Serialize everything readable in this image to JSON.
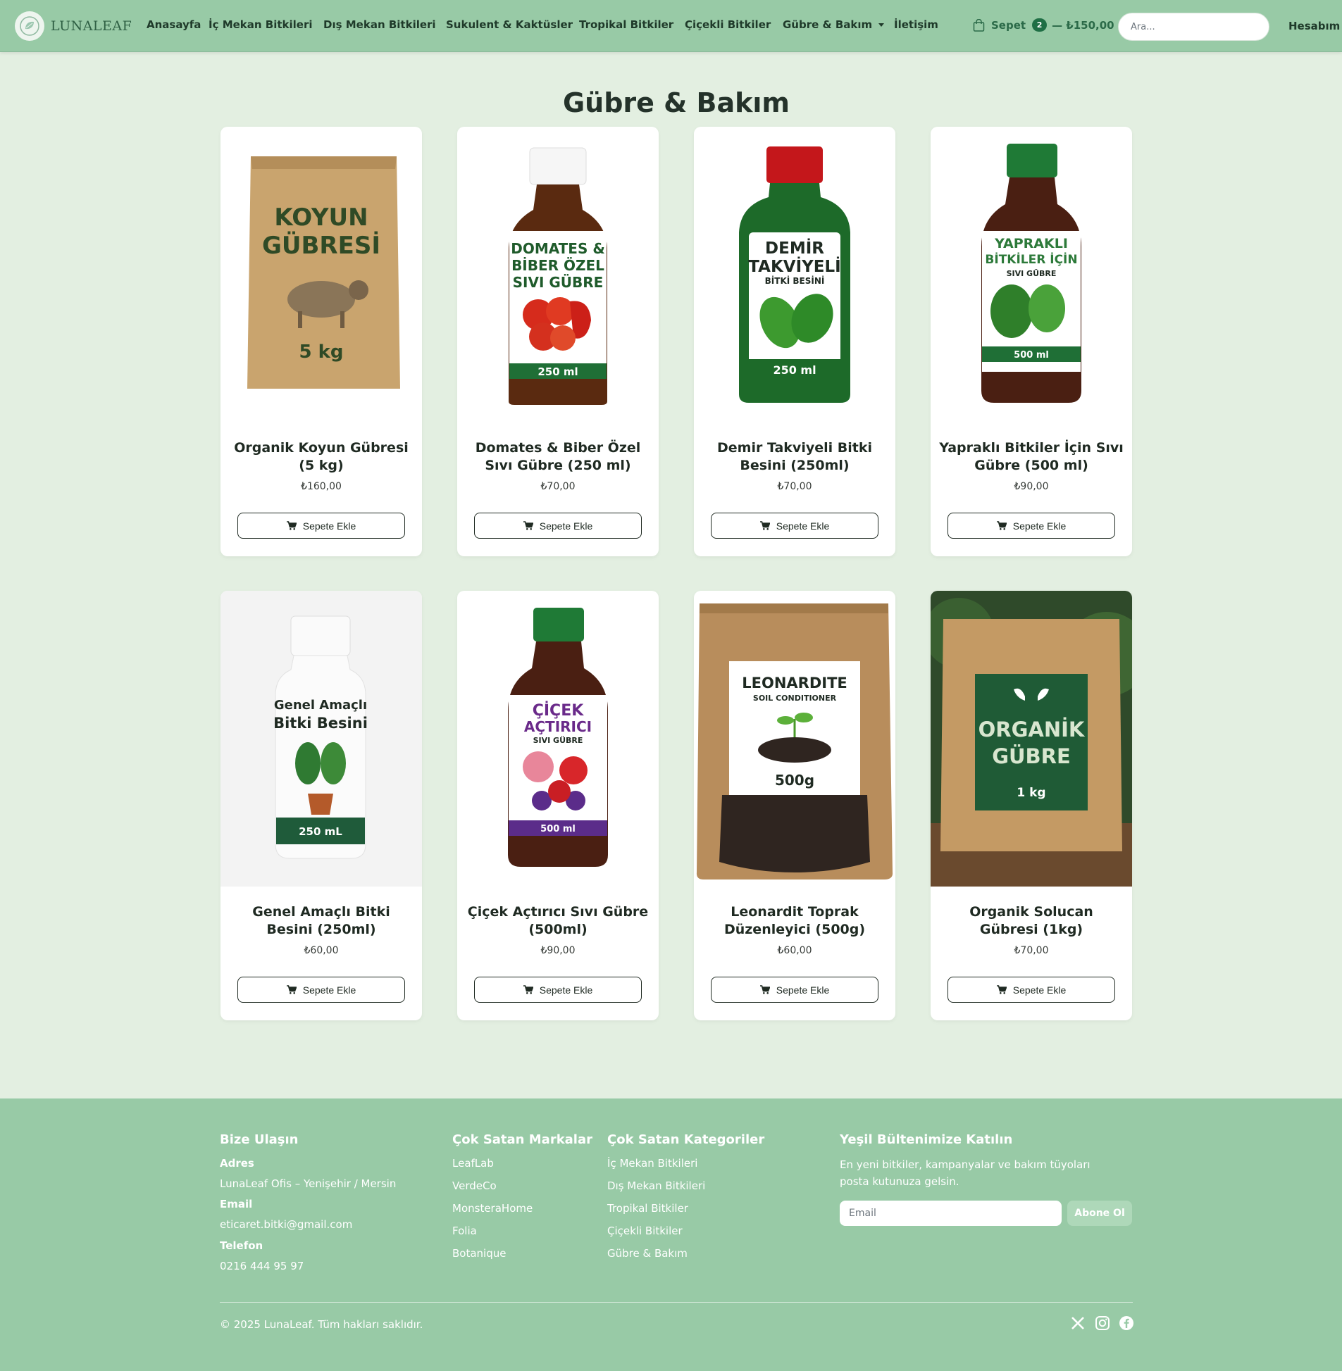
{
  "brand": {
    "name": "LUNALEAF"
  },
  "nav": {
    "links": [
      "Anasayfa",
      "İç Mekan Bitkileri",
      "Dış Mekan Bitkileri",
      "Sukulent & Kaktüsler",
      "Tropikal Bitkiler",
      "Çiçekli Bitkiler",
      "Gübre & Bakım",
      "İletişim"
    ],
    "cart_label": "Sepet",
    "cart_count": "2",
    "cart_total": "— ₺150,00",
    "search_placeholder": "Ara...",
    "account_label": "Hesabım"
  },
  "page": {
    "title": "Gübre & Bakım"
  },
  "products": [
    {
      "name": "Organik Koyun Gübresi (5 kg)",
      "price": "₺160,00",
      "button": "Sepete Ekle",
      "image_text": [
        "KOYUN",
        "GÜBRESİ",
        "5 kg"
      ]
    },
    {
      "name": "Domates & Biber Özel Sıvı Gübre (250 ml)",
      "price": "₺70,00",
      "button": "Sepete Ekle",
      "image_text": [
        "DOMATES &",
        "BİBER ÖZEL",
        "SIVI GÜBRE",
        "250 ml"
      ]
    },
    {
      "name": "Demir Takviyeli Bitki Besini (250ml)",
      "price": "₺70,00",
      "button": "Sepete Ekle",
      "image_text": [
        "DEMİR",
        "TAKVİYELİ",
        "BİTKİ BESİNİ",
        "250 ml"
      ]
    },
    {
      "name": "Yapraklı Bitkiler İçin Sıvı Gübre (500 ml)",
      "price": "₺90,00",
      "button": "Sepete Ekle",
      "image_text": [
        "YAPRAKLI",
        "BİTKİLER İÇİN",
        "SIVI GÜBRE",
        "500 ml"
      ]
    },
    {
      "name": "Genel Amaçlı Bitki Besini (250ml)",
      "price": "₺60,00",
      "button": "Sepete Ekle",
      "image_text": [
        "Genel Amaçlı",
        "Bitki Besini",
        "250 mL"
      ]
    },
    {
      "name": "Çiçek Açtırıcı Sıvı Gübre (500ml)",
      "price": "₺90,00",
      "button": "Sepete Ekle",
      "image_text": [
        "ÇİÇEK",
        "AÇTIRICI",
        "SIVI GÜBRE",
        "500 ml"
      ]
    },
    {
      "name": "Leonardit Toprak Düzenleyici (500g)",
      "price": "₺60,00",
      "button": "Sepete Ekle",
      "image_text": [
        "LEONARDITE",
        "SOIL CONDITIONER",
        "500g"
      ]
    },
    {
      "name": "Organik Solucan Gübresi (1kg)",
      "price": "₺70,00",
      "button": "Sepete Ekle",
      "image_text": [
        "ORGANİK",
        "GÜBRE",
        "1 kg"
      ]
    }
  ],
  "footer": {
    "contact": {
      "title": "Bize Ulaşın",
      "address_label": "Adres",
      "address": "LunaLeaf Ofis – Yenişehir / Mersin",
      "email_label": "Email",
      "email": "eticaret.bitki@gmail.com",
      "phone_label": "Telefon",
      "phone": "0216 444 95 97"
    },
    "brands": {
      "title": "Çok Satan Markalar",
      "items": [
        "LeafLab",
        "VerdeCo",
        "MonsteraHome",
        "Folia",
        "Botanique"
      ]
    },
    "categories": {
      "title": "Çok Satan Kategoriler",
      "items": [
        "İç Mekan Bitkileri",
        "Dış Mekan Bitkileri",
        "Tropikal Bitkiler",
        "Çiçekli Bitkiler",
        "Gübre & Bakım"
      ]
    },
    "newsletter": {
      "title": "Yeşil Bültenimize Katılın",
      "description": "En yeni bitkiler, kampanyalar ve bakım tüyoları posta kutunuza gelsin.",
      "email_placeholder": "Email",
      "button": "Abone Ol"
    },
    "copyright": "© 2025 LunaLeaf. Tüm hakları saklıdır."
  },
  "colors": {
    "header_bg": "#98caa6",
    "page_bg": "#e3efe1",
    "footer_bg": "#98caa6",
    "accent": "#1f6f45"
  }
}
